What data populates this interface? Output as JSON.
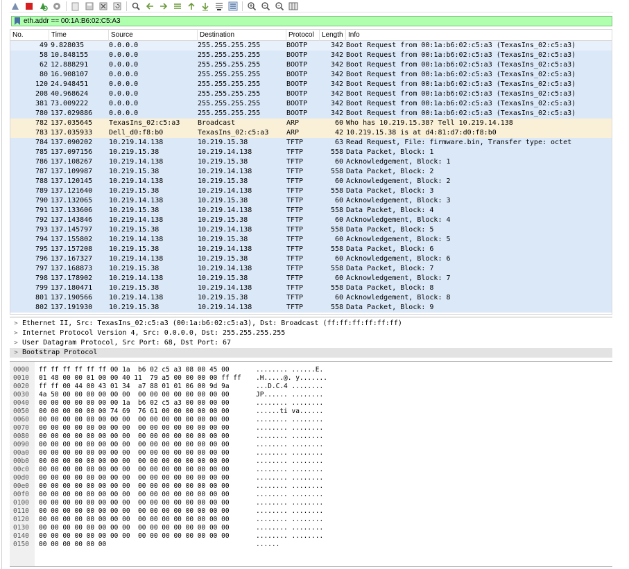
{
  "filter": {
    "value": "eth.addr == 00:1A:B6:02:C5:A3"
  },
  "toolbar": {
    "icons": [
      "shark-fin-icon",
      "stop-icon",
      "restart-icon",
      "options-gear-icon",
      "open-file-icon",
      "save-file-icon",
      "close-file-icon",
      "reload-icon",
      "find-icon",
      "go-back-icon",
      "go-forward-icon",
      "go-to-packet-icon",
      "first-packet-icon",
      "last-packet-icon",
      "autoscroll-icon",
      "colorize-icon",
      "zoom-in-icon",
      "zoom-out-icon",
      "normal-size-icon",
      "resize-columns-icon"
    ]
  },
  "columns": [
    "No.",
    "Time",
    "Source",
    "Destination",
    "Protocol",
    "Length",
    "Info"
  ],
  "packets": [
    {
      "no": "49",
      "time": "9.828035",
      "src": "0.0.0.0",
      "dst": "255.255.255.255",
      "proto": "BOOTP",
      "len": "342",
      "info": "Boot Request from 00:1a:b6:02:c5:a3 (TexasIns_02:c5:a3)",
      "cls": "first"
    },
    {
      "no": "58",
      "time": "10.848155",
      "src": "0.0.0.0",
      "dst": "255.255.255.255",
      "proto": "BOOTP",
      "len": "342",
      "info": "Boot Request from 00:1a:b6:02:c5:a3 (TexasIns_02:c5:a3)",
      "cls": "bootp"
    },
    {
      "no": "62",
      "time": "12.888291",
      "src": "0.0.0.0",
      "dst": "255.255.255.255",
      "proto": "BOOTP",
      "len": "342",
      "info": "Boot Request from 00:1a:b6:02:c5:a3 (TexasIns_02:c5:a3)",
      "cls": "bootp"
    },
    {
      "no": "80",
      "time": "16.908107",
      "src": "0.0.0.0",
      "dst": "255.255.255.255",
      "proto": "BOOTP",
      "len": "342",
      "info": "Boot Request from 00:1a:b6:02:c5:a3 (TexasIns_02:c5:a3)",
      "cls": "bootp"
    },
    {
      "no": "120",
      "time": "24.948451",
      "src": "0.0.0.0",
      "dst": "255.255.255.255",
      "proto": "BOOTP",
      "len": "342",
      "info": "Boot Request from 00:1a:b6:02:c5:a3 (TexasIns_02:c5:a3)",
      "cls": "bootp"
    },
    {
      "no": "208",
      "time": "40.968624",
      "src": "0.0.0.0",
      "dst": "255.255.255.255",
      "proto": "BOOTP",
      "len": "342",
      "info": "Boot Request from 00:1a:b6:02:c5:a3 (TexasIns_02:c5:a3)",
      "cls": "bootp"
    },
    {
      "no": "381",
      "time": "73.009222",
      "src": "0.0.0.0",
      "dst": "255.255.255.255",
      "proto": "BOOTP",
      "len": "342",
      "info": "Boot Request from 00:1a:b6:02:c5:a3 (TexasIns_02:c5:a3)",
      "cls": "bootp"
    },
    {
      "no": "780",
      "time": "137.029886",
      "src": "0.0.0.0",
      "dst": "255.255.255.255",
      "proto": "BOOTP",
      "len": "342",
      "info": "Boot Request from 00:1a:b6:02:c5:a3 (TexasIns_02:c5:a3)",
      "cls": "bootp"
    },
    {
      "no": "782",
      "time": "137.035645",
      "src": "TexasIns_02:c5:a3",
      "dst": "Broadcast",
      "proto": "ARP",
      "len": "60",
      "info": "Who has 10.219.15.38? Tell 10.219.14.138",
      "cls": "arp"
    },
    {
      "no": "783",
      "time": "137.035933",
      "src": "Dell_d0:f8:b0",
      "dst": "TexasIns_02:c5:a3",
      "proto": "ARP",
      "len": "42",
      "info": "10.219.15.38 is at d4:81:d7:d0:f8:b0",
      "cls": "arp"
    },
    {
      "no": "784",
      "time": "137.090202",
      "src": "10.219.14.138",
      "dst": "10.219.15.38",
      "proto": "TFTP",
      "len": "63",
      "info": "Read Request, File: firmware.bin, Transfer type: octet",
      "cls": "tftp"
    },
    {
      "no": "785",
      "time": "137.097156",
      "src": "10.219.15.38",
      "dst": "10.219.14.138",
      "proto": "TFTP",
      "len": "558",
      "info": "Data Packet, Block: 1",
      "cls": "tftp"
    },
    {
      "no": "786",
      "time": "137.108267",
      "src": "10.219.14.138",
      "dst": "10.219.15.38",
      "proto": "TFTP",
      "len": "60",
      "info": "Acknowledgement, Block: 1",
      "cls": "tftp"
    },
    {
      "no": "787",
      "time": "137.109987",
      "src": "10.219.15.38",
      "dst": "10.219.14.138",
      "proto": "TFTP",
      "len": "558",
      "info": "Data Packet, Block: 2",
      "cls": "tftp"
    },
    {
      "no": "788",
      "time": "137.120145",
      "src": "10.219.14.138",
      "dst": "10.219.15.38",
      "proto": "TFTP",
      "len": "60",
      "info": "Acknowledgement, Block: 2",
      "cls": "tftp"
    },
    {
      "no": "789",
      "time": "137.121640",
      "src": "10.219.15.38",
      "dst": "10.219.14.138",
      "proto": "TFTP",
      "len": "558",
      "info": "Data Packet, Block: 3",
      "cls": "tftp"
    },
    {
      "no": "790",
      "time": "137.132065",
      "src": "10.219.14.138",
      "dst": "10.219.15.38",
      "proto": "TFTP",
      "len": "60",
      "info": "Acknowledgement, Block: 3",
      "cls": "tftp"
    },
    {
      "no": "791",
      "time": "137.133606",
      "src": "10.219.15.38",
      "dst": "10.219.14.138",
      "proto": "TFTP",
      "len": "558",
      "info": "Data Packet, Block: 4",
      "cls": "tftp"
    },
    {
      "no": "792",
      "time": "137.143846",
      "src": "10.219.14.138",
      "dst": "10.219.15.38",
      "proto": "TFTP",
      "len": "60",
      "info": "Acknowledgement, Block: 4",
      "cls": "tftp"
    },
    {
      "no": "793",
      "time": "137.145797",
      "src": "10.219.15.38",
      "dst": "10.219.14.138",
      "proto": "TFTP",
      "len": "558",
      "info": "Data Packet, Block: 5",
      "cls": "tftp"
    },
    {
      "no": "794",
      "time": "137.155802",
      "src": "10.219.14.138",
      "dst": "10.219.15.38",
      "proto": "TFTP",
      "len": "60",
      "info": "Acknowledgement, Block: 5",
      "cls": "tftp"
    },
    {
      "no": "795",
      "time": "137.157208",
      "src": "10.219.15.38",
      "dst": "10.219.14.138",
      "proto": "TFTP",
      "len": "558",
      "info": "Data Packet, Block: 6",
      "cls": "tftp"
    },
    {
      "no": "796",
      "time": "137.167327",
      "src": "10.219.14.138",
      "dst": "10.219.15.38",
      "proto": "TFTP",
      "len": "60",
      "info": "Acknowledgement, Block: 6",
      "cls": "tftp"
    },
    {
      "no": "797",
      "time": "137.168873",
      "src": "10.219.15.38",
      "dst": "10.219.14.138",
      "proto": "TFTP",
      "len": "558",
      "info": "Data Packet, Block: 7",
      "cls": "tftp"
    },
    {
      "no": "798",
      "time": "137.178902",
      "src": "10.219.14.138",
      "dst": "10.219.15.38",
      "proto": "TFTP",
      "len": "60",
      "info": "Acknowledgement, Block: 7",
      "cls": "tftp"
    },
    {
      "no": "799",
      "time": "137.180471",
      "src": "10.219.15.38",
      "dst": "10.219.14.138",
      "proto": "TFTP",
      "len": "558",
      "info": "Data Packet, Block: 8",
      "cls": "tftp"
    },
    {
      "no": "801",
      "time": "137.190566",
      "src": "10.219.14.138",
      "dst": "10.219.15.38",
      "proto": "TFTP",
      "len": "60",
      "info": "Acknowledgement, Block: 8",
      "cls": "tftp"
    },
    {
      "no": "802",
      "time": "137.191930",
      "src": "10.219.15.38",
      "dst": "10.219.14.138",
      "proto": "TFTP",
      "len": "558",
      "info": "Data Packet, Block: 9",
      "cls": "tftp"
    }
  ],
  "details": [
    {
      "text": "Ethernet II, Src: TexasIns_02:c5:a3 (00:1a:b6:02:c5:a3), Dst: Broadcast (ff:ff:ff:ff:ff:ff)",
      "expander": ">",
      "selected": false
    },
    {
      "text": "Internet Protocol Version 4, Src: 0.0.0.0, Dst: 255.255.255.255",
      "expander": ">",
      "selected": false
    },
    {
      "text": "User Datagram Protocol, Src Port: 68, Dst Port: 67",
      "expander": ">",
      "selected": false
    },
    {
      "text": "Bootstrap Protocol",
      "expander": ">",
      "selected": true
    }
  ],
  "hex": [
    {
      "off": "0000",
      "bytes": "ff ff ff ff ff ff 00 1a  b6 02 c5 a3 08 00 45 00",
      "ascii": "........ ......E."
    },
    {
      "off": "0010",
      "bytes": "01 48 00 00 01 00 00 40 11  79 a5 00 00 00 00 ff ff",
      "ascii": ".H.....@. y......."
    },
    {
      "off": "0020",
      "bytes": "ff ff 00 44 00 43 01 34  a7 88 01 01 06 00 9d 9a",
      "ascii": "...D.C.4 ........"
    },
    {
      "off": "0030",
      "bytes": "4a 50 00 00 00 00 00 00  00 00 00 00 00 00 00 00",
      "ascii": "JP...... ........"
    },
    {
      "off": "0040",
      "bytes": "00 00 00 00 00 00 00 1a  b6 02 c5 a3 00 00 00 00",
      "ascii": "........ ........"
    },
    {
      "off": "0050",
      "bytes": "00 00 00 00 00 00 74 69  76 61 00 00 00 00 00 00",
      "ascii": "......ti va......"
    },
    {
      "off": "0060",
      "bytes": "00 00 00 00 00 00 00 00  00 00 00 00 00 00 00 00",
      "ascii": "........ ........"
    },
    {
      "off": "0070",
      "bytes": "00 00 00 00 00 00 00 00  00 00 00 00 00 00 00 00",
      "ascii": "........ ........"
    },
    {
      "off": "0080",
      "bytes": "00 00 00 00 00 00 00 00  00 00 00 00 00 00 00 00",
      "ascii": "........ ........"
    },
    {
      "off": "0090",
      "bytes": "00 00 00 00 00 00 00 00  00 00 00 00 00 00 00 00",
      "ascii": "........ ........"
    },
    {
      "off": "00a0",
      "bytes": "00 00 00 00 00 00 00 00  00 00 00 00 00 00 00 00",
      "ascii": "........ ........"
    },
    {
      "off": "00b0",
      "bytes": "00 00 00 00 00 00 00 00  00 00 00 00 00 00 00 00",
      "ascii": "........ ........"
    },
    {
      "off": "00c0",
      "bytes": "00 00 00 00 00 00 00 00  00 00 00 00 00 00 00 00",
      "ascii": "........ ........"
    },
    {
      "off": "00d0",
      "bytes": "00 00 00 00 00 00 00 00  00 00 00 00 00 00 00 00",
      "ascii": "........ ........"
    },
    {
      "off": "00e0",
      "bytes": "00 00 00 00 00 00 00 00  00 00 00 00 00 00 00 00",
      "ascii": "........ ........"
    },
    {
      "off": "00f0",
      "bytes": "00 00 00 00 00 00 00 00  00 00 00 00 00 00 00 00",
      "ascii": "........ ........"
    },
    {
      "off": "0100",
      "bytes": "00 00 00 00 00 00 00 00  00 00 00 00 00 00 00 00",
      "ascii": "........ ........"
    },
    {
      "off": "0110",
      "bytes": "00 00 00 00 00 00 00 00  00 00 00 00 00 00 00 00",
      "ascii": "........ ........"
    },
    {
      "off": "0120",
      "bytes": "00 00 00 00 00 00 00 00  00 00 00 00 00 00 00 00",
      "ascii": "........ ........"
    },
    {
      "off": "0130",
      "bytes": "00 00 00 00 00 00 00 00  00 00 00 00 00 00 00 00",
      "ascii": "........ ........"
    },
    {
      "off": "0140",
      "bytes": "00 00 00 00 00 00 00 00  00 00 00 00 00 00 00 00",
      "ascii": "........ ........"
    },
    {
      "off": "0150",
      "bytes": "00 00 00 00 00 00",
      "ascii": "......"
    }
  ],
  "colors": {
    "filter_ok": "#afffaf",
    "row_udp": "#dae8f8",
    "row_arp": "#faf0d7",
    "selected_detail": "#e3e3e3"
  }
}
